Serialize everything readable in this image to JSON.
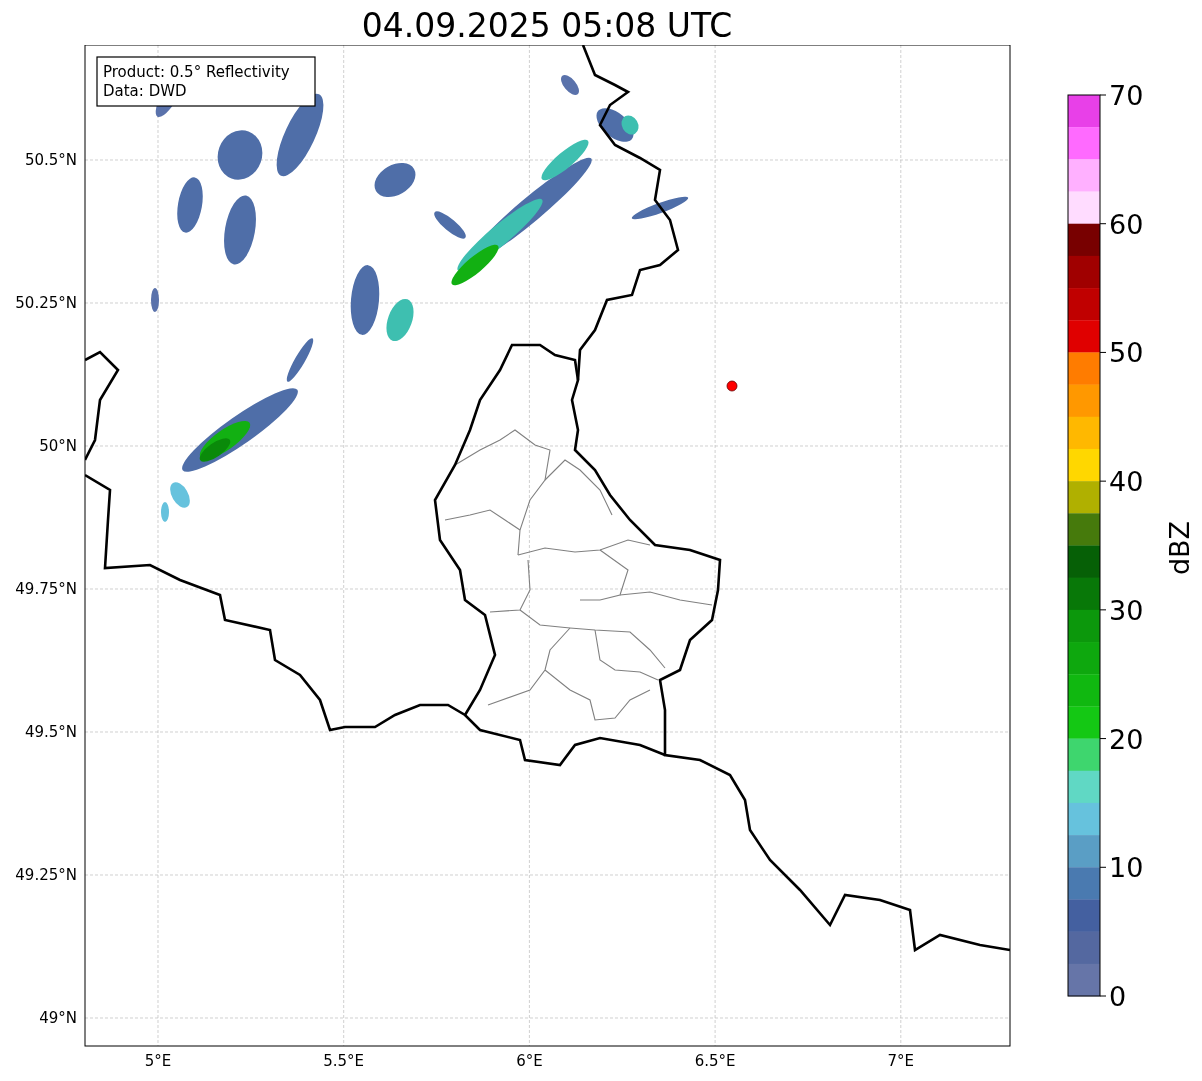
{
  "title": "04.09.2025 05:08 UTC",
  "legend": [
    "Product: 0.5° Reflectivity",
    "Data: DWD"
  ],
  "map": {
    "yticks": [
      "50.5°N",
      "50.25°N",
      "50°N",
      "49.75°N",
      "49.5°N",
      "49.25°N",
      "49°N"
    ],
    "xticks": [
      "5°E",
      "5.5°E",
      "6°E",
      "6.5°E",
      "7°E"
    ]
  },
  "colorbar": {
    "label": "dBZ",
    "ticks": [
      "70",
      "60",
      "50",
      "40",
      "30",
      "20",
      "10",
      "0"
    ],
    "bins": [
      {
        "color": "#e840e8"
      },
      {
        "color": "#ff6aff"
      },
      {
        "color": "#ffb0ff"
      },
      {
        "color": "#ffdcff"
      },
      {
        "color": "#780000"
      },
      {
        "color": "#a00000"
      },
      {
        "color": "#c00000"
      },
      {
        "color": "#e00000"
      },
      {
        "color": "#ff7c00"
      },
      {
        "color": "#ff9800"
      },
      {
        "color": "#ffb800"
      },
      {
        "color": "#ffd700"
      },
      {
        "color": "#b0b000"
      },
      {
        "color": "#467a0c"
      },
      {
        "color": "#066006"
      },
      {
        "color": "#087808"
      },
      {
        "color": "#0c980c"
      },
      {
        "color": "#0ea80e"
      },
      {
        "color": "#10b810"
      },
      {
        "color": "#14c814"
      },
      {
        "color": "#3ed66e"
      },
      {
        "color": "#60d8c4"
      },
      {
        "color": "#66c2dd"
      },
      {
        "color": "#5a9ec5"
      },
      {
        "color": "#4a7ab0"
      },
      {
        "color": "#4460a0"
      },
      {
        "color": "#5468a0"
      },
      {
        "color": "#6675a8"
      }
    ]
  }
}
